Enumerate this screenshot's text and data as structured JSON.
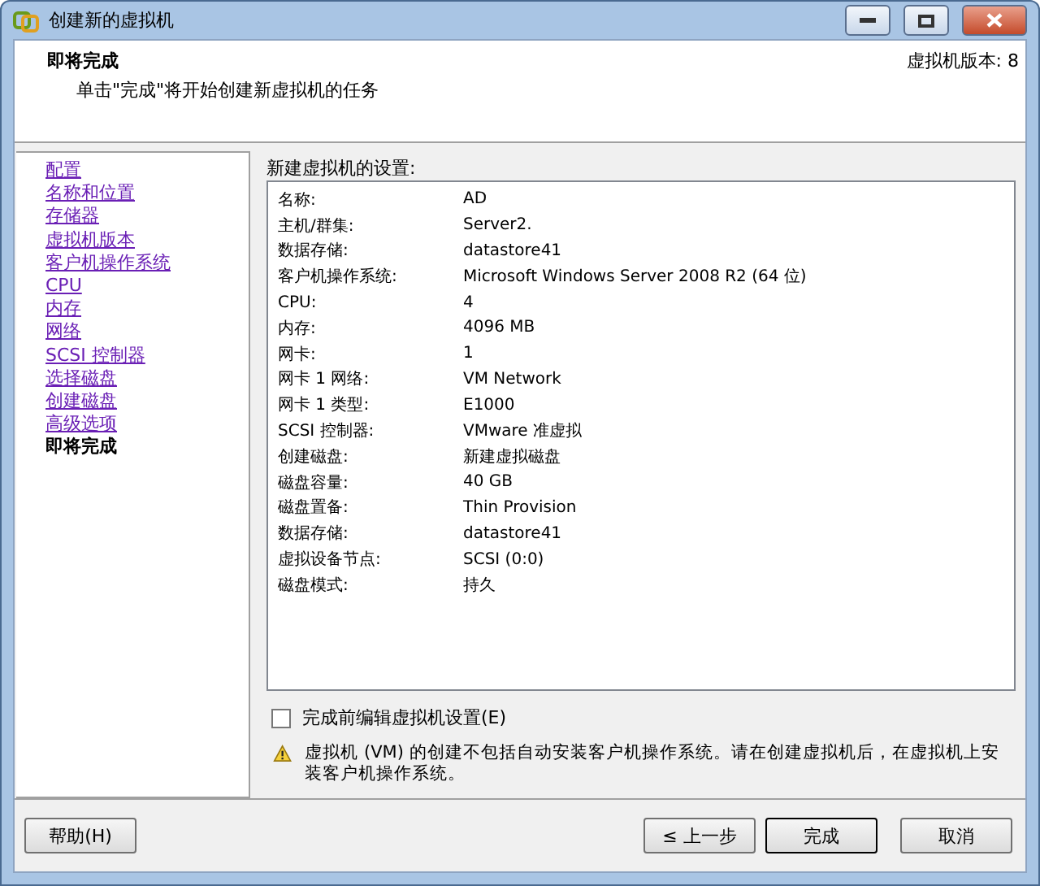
{
  "window": {
    "title": "创建新的虚拟机"
  },
  "header": {
    "title": "即将完成",
    "subtitle": "单击\"完成\"将开始创建新虚拟机的任务",
    "version": "虚拟机版本: 8"
  },
  "nav": [
    {
      "label": "配置",
      "selected": false
    },
    {
      "label": "名称和位置",
      "selected": false
    },
    {
      "label": "存储器",
      "selected": false
    },
    {
      "label": "虚拟机版本",
      "selected": false
    },
    {
      "label": "客户机操作系统",
      "selected": false
    },
    {
      "label": "CPU",
      "selected": false
    },
    {
      "label": "内存",
      "selected": false
    },
    {
      "label": "网络",
      "selected": false
    },
    {
      "label": "SCSI 控制器",
      "selected": false
    },
    {
      "label": "选择磁盘",
      "selected": false
    },
    {
      "label": "创建磁盘",
      "selected": false
    },
    {
      "label": "高级选项",
      "selected": false
    },
    {
      "label": "即将完成",
      "selected": true
    }
  ],
  "settings": {
    "title": "新建虚拟机的设置:",
    "rows": [
      {
        "label": "名称:",
        "value": "AD"
      },
      {
        "label": "主机/群集:",
        "value": "Server2."
      },
      {
        "label": "数据存储:",
        "value": "datastore41"
      },
      {
        "label": "客户机操作系统:",
        "value": "Microsoft Windows Server 2008 R2 (64 位)"
      },
      {
        "label": "CPU:",
        "value": "4"
      },
      {
        "label": "内存:",
        "value": "4096 MB"
      },
      {
        "label": "网卡:",
        "value": "1"
      },
      {
        "label": "网卡 1 网络:",
        "value": "VM Network"
      },
      {
        "label": "网卡 1 类型:",
        "value": "E1000"
      },
      {
        "label": "SCSI 控制器:",
        "value": "VMware 准虚拟"
      },
      {
        "label": "创建磁盘:",
        "value": "新建虚拟磁盘"
      },
      {
        "label": "磁盘容量:",
        "value": "40 GB"
      },
      {
        "label": "磁盘置备:",
        "value": "Thin Provision"
      },
      {
        "label": "数据存储:",
        "value": "datastore41"
      },
      {
        "label": "虚拟设备节点:",
        "value": "SCSI (0:0)"
      },
      {
        "label": "磁盘模式:",
        "value": "持久"
      }
    ]
  },
  "edit_checkbox": {
    "label": "完成前编辑虚拟机设置(E)",
    "checked": false
  },
  "warning": "虚拟机 (VM) 的创建不包括自动安装客户机操作系统。请在创建虚拟机后，在虚拟机上安装客户机操作系统。",
  "buttons": {
    "help": "帮助(H)",
    "back": "≤ 上一步",
    "finish": "完成",
    "cancel": "取消"
  }
}
